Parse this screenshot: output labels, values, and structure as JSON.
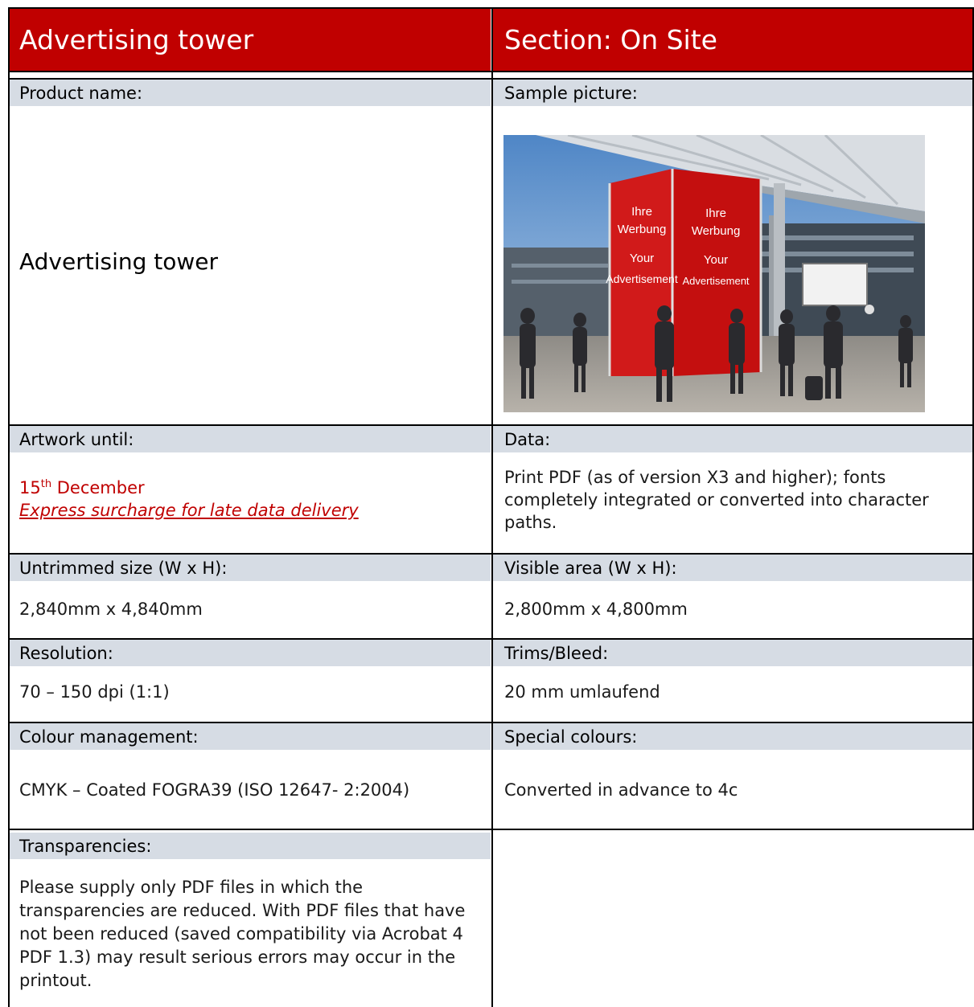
{
  "header": {
    "title": "Advertising tower",
    "section": "Section: On Site"
  },
  "product": {
    "label": "Product name:",
    "value": "Advertising tower"
  },
  "sample": {
    "label": "Sample picture:",
    "image_text": {
      "line1": "Ihre",
      "line2": "Werbung",
      "line3": "Your",
      "line4": "Advertisement"
    }
  },
  "artwork": {
    "label": "Artwork until:",
    "date_day": "15",
    "date_suffix": "th",
    "date_month": " December",
    "link": "Express surcharge for late data delivery"
  },
  "data_field": {
    "label": "Data:",
    "value": "Print PDF (as of version X3 and higher); fonts completely integrated or converted into character paths."
  },
  "untrimmed": {
    "label": "Untrimmed size (W x H):",
    "value": "2,840mm x 4,840mm"
  },
  "visible": {
    "label": "Visible area (W x H):",
    "value": "2,800mm x 4,800mm"
  },
  "resolution": {
    "label": "Resolution:",
    "value": "70 – 150 dpi (1:1)"
  },
  "trims": {
    "label": "Trims/Bleed:",
    "value": "20 mm umlaufend"
  },
  "colour": {
    "label": "Colour management:",
    "value": "CMYK – Coated FOGRA39 (ISO 12647- 2:2004)"
  },
  "special": {
    "label": "Special colours:",
    "value": "Converted in advance to 4c"
  },
  "transparencies": {
    "label": "Transparencies:",
    "value": "Please supply only PDF files in which the transparencies are reduced. With PDF files that have not been reduced (saved compatibility via Acrobat 4 PDF 1.3) may result serious errors may occur in the printout."
  },
  "colors": {
    "header_red": "#c00000",
    "label_bg": "#d6dce4",
    "link_red": "#c00000"
  }
}
